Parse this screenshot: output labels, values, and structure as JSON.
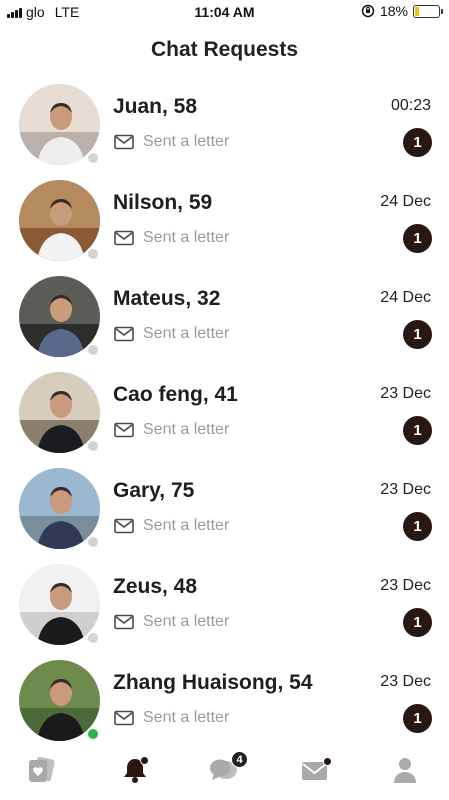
{
  "status_bar": {
    "carrier": "glo",
    "network": "LTE",
    "time": "11:04 AM",
    "battery": "18%",
    "battery_level": 0.18
  },
  "header": {
    "title": "Chat Requests"
  },
  "requests": [
    {
      "name": "Juan, 58",
      "date": "00:23",
      "preview": "Sent a letter",
      "badge": "1",
      "online": false,
      "colors": [
        "#e8ddd2",
        "#b9b2ac",
        "#eeeeee"
      ]
    },
    {
      "name": "Nilson, 59",
      "date": "24 Dec",
      "preview": "Sent a letter",
      "badge": "1",
      "online": false,
      "colors": [
        "#b58a5e",
        "#8a5a35",
        "#f2f2f2"
      ]
    },
    {
      "name": "Mateus, 32",
      "date": "24 Dec",
      "preview": "Sent a letter",
      "badge": "1",
      "online": false,
      "colors": [
        "#5a5d55",
        "#2c2e2b",
        "#59698a"
      ]
    },
    {
      "name": "Cao feng, 41",
      "date": "23 Dec",
      "preview": "Sent a letter",
      "badge": "1",
      "online": false,
      "colors": [
        "#d6cdbd",
        "#8b7f6e",
        "#1b1b22"
      ]
    },
    {
      "name": "Gary, 75",
      "date": "23 Dec",
      "preview": "Sent a letter",
      "badge": "1",
      "online": false,
      "colors": [
        "#9bb8d1",
        "#7a8d9a",
        "#2f3b55"
      ]
    },
    {
      "name": "Zeus, 48",
      "date": "23 Dec",
      "preview": "Sent a letter",
      "badge": "1",
      "online": false,
      "colors": [
        "#f1f1f1",
        "#cfcfcf",
        "#1a1a1a"
      ]
    },
    {
      "name": "Zhang Huaisong, 54",
      "date": "23 Dec",
      "preview": "Sent a letter",
      "badge": "1",
      "online": true,
      "colors": [
        "#6e8a4c",
        "#4a6a3a",
        "#1a1a1a"
      ]
    }
  ],
  "bottom_nav": {
    "items": [
      {
        "icon": "cards-heart-icon"
      },
      {
        "icon": "bell-icon",
        "dot": true
      },
      {
        "icon": "chat-bubbles-icon",
        "badge": "4"
      },
      {
        "icon": "mail-icon",
        "dot": true
      },
      {
        "icon": "profile-icon"
      }
    ]
  }
}
